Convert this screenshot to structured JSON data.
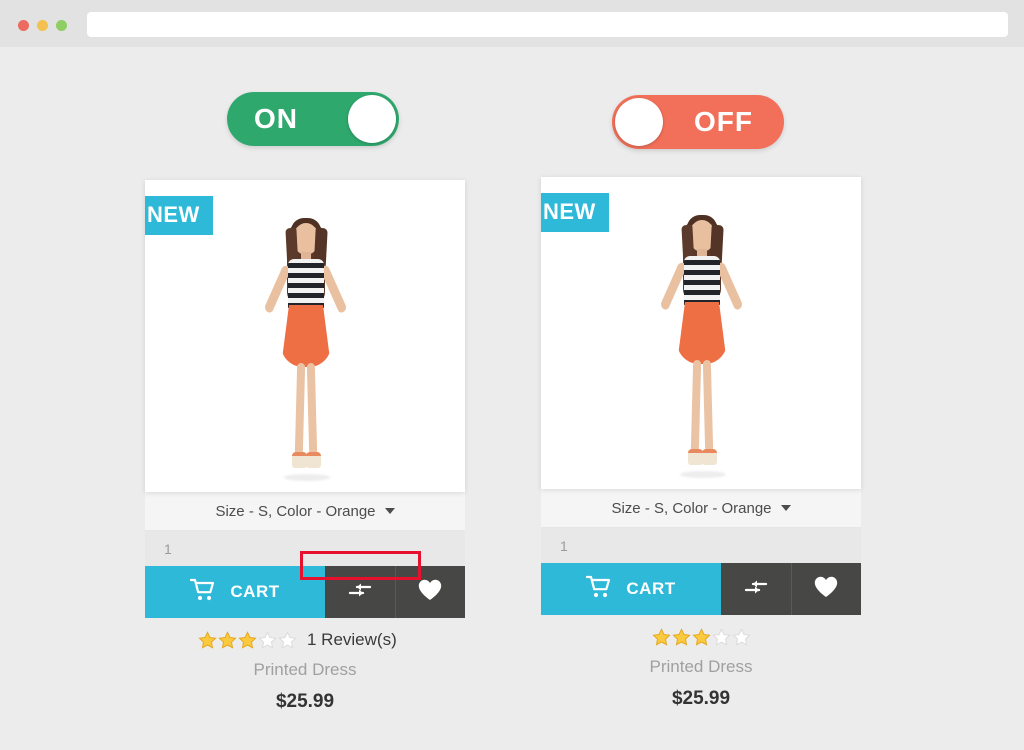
{
  "browser": {
    "traffic_lights": [
      "close",
      "minimize",
      "maximize"
    ],
    "url_value": "",
    "url_placeholder": ""
  },
  "toggles": [
    {
      "state_label": "ON",
      "state": "on",
      "color": "#2fa86d",
      "knob_color": "#ffffff"
    },
    {
      "state_label": "OFF",
      "state": "off",
      "color": "#f2705a",
      "knob_color": "#ffffff"
    }
  ],
  "annotation": {
    "type": "highlight-box",
    "color": "#e8112d",
    "targets": "1 Review(s)"
  },
  "products": [
    {
      "badge": "NEW",
      "badge_color": "#2fb9d8",
      "option_label": "Size - S, Color - Orange",
      "quantity_value": "1",
      "quantity_placeholder": "1",
      "cart_label": "CART",
      "cart_color": "#2fb9d8",
      "compare_icon": "compare-arrows-icon",
      "wishlist_icon": "heart-icon",
      "rating_filled": 3,
      "rating_total": 5,
      "review_text": "1 Review(s)",
      "has_review_text": true,
      "name": "Printed Dress",
      "price": "$25.99"
    },
    {
      "badge": "NEW",
      "badge_color": "#2fb9d8",
      "option_label": "Size - S, Color - Orange",
      "quantity_value": "1",
      "quantity_placeholder": "1",
      "cart_label": "CART",
      "cart_color": "#2fb9d8",
      "compare_icon": "compare-arrows-icon",
      "wishlist_icon": "heart-icon",
      "rating_filled": 3,
      "rating_total": 5,
      "review_text": "",
      "has_review_text": false,
      "name": "Printed Dress",
      "price": "$25.99"
    }
  ]
}
